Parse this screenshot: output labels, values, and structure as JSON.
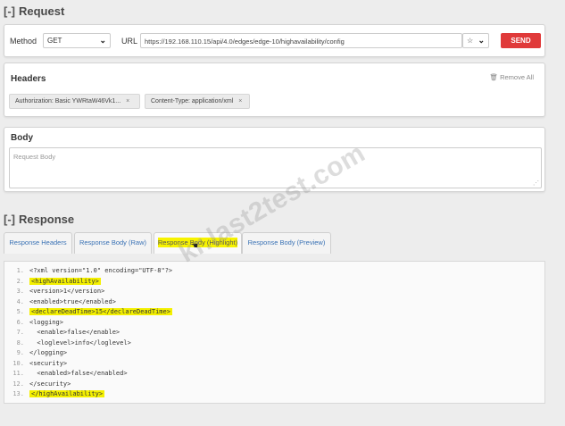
{
  "request": {
    "section_bracket": "[-]",
    "section_title": "Request",
    "method_label": "Method",
    "method_value": "GET",
    "url_label": "URL",
    "url_value": "https://192.168.110.15/api/4.0/edges/edge-10/highavailability/config",
    "star_icon": "☆",
    "send_label": "SEND"
  },
  "headers": {
    "title": "Headers",
    "remove_all": "Remove All",
    "items": [
      {
        "text": "Authorization: Basic YWRtaW46Vk1..."
      },
      {
        "text": "Content-Type: application/xml"
      }
    ]
  },
  "body": {
    "title": "Body",
    "placeholder": "Request Body"
  },
  "response": {
    "section_bracket": "[-]",
    "section_title": "Response",
    "tabs": [
      {
        "label": "Response Headers"
      },
      {
        "label": "Response Body (Raw)"
      },
      {
        "label": "Response Body (Highlight)"
      },
      {
        "label": "Response Body (Preview)"
      }
    ],
    "active_tab": 2,
    "lines": [
      {
        "n": "1.",
        "text": "<?xml version=\"1.0\" encoding=\"UTF-8\"?>",
        "highlight": false
      },
      {
        "n": "2.",
        "text": "<highAvailability>",
        "highlight": true
      },
      {
        "n": "3.",
        "text": "<version>1</version>",
        "highlight": false
      },
      {
        "n": "4.",
        "text": "<enabled>true</enabled>",
        "highlight": false
      },
      {
        "n": "5.",
        "text": "<declareDeadTime>15</declareDeadTime>",
        "highlight": true
      },
      {
        "n": "6.",
        "text": "<logging>",
        "highlight": false
      },
      {
        "n": "7.",
        "text": "  <enable>false</enable>",
        "highlight": false
      },
      {
        "n": "8.",
        "text": "  <loglevel>info</loglevel>",
        "highlight": false
      },
      {
        "n": "9.",
        "text": "</logging>",
        "highlight": false
      },
      {
        "n": "10.",
        "text": "<security>",
        "highlight": false
      },
      {
        "n": "11.",
        "text": "  <enabled>false</enabled>",
        "highlight": false
      },
      {
        "n": "12.",
        "text": "</security>",
        "highlight": false
      },
      {
        "n": "13.",
        "text": "</highAvailability>",
        "highlight": true
      }
    ]
  },
  "watermark": "kr.last2test.com",
  "colors": {
    "send": "#e03a3a",
    "highlight": "#f4f000",
    "tab_link": "#3a72b5"
  }
}
